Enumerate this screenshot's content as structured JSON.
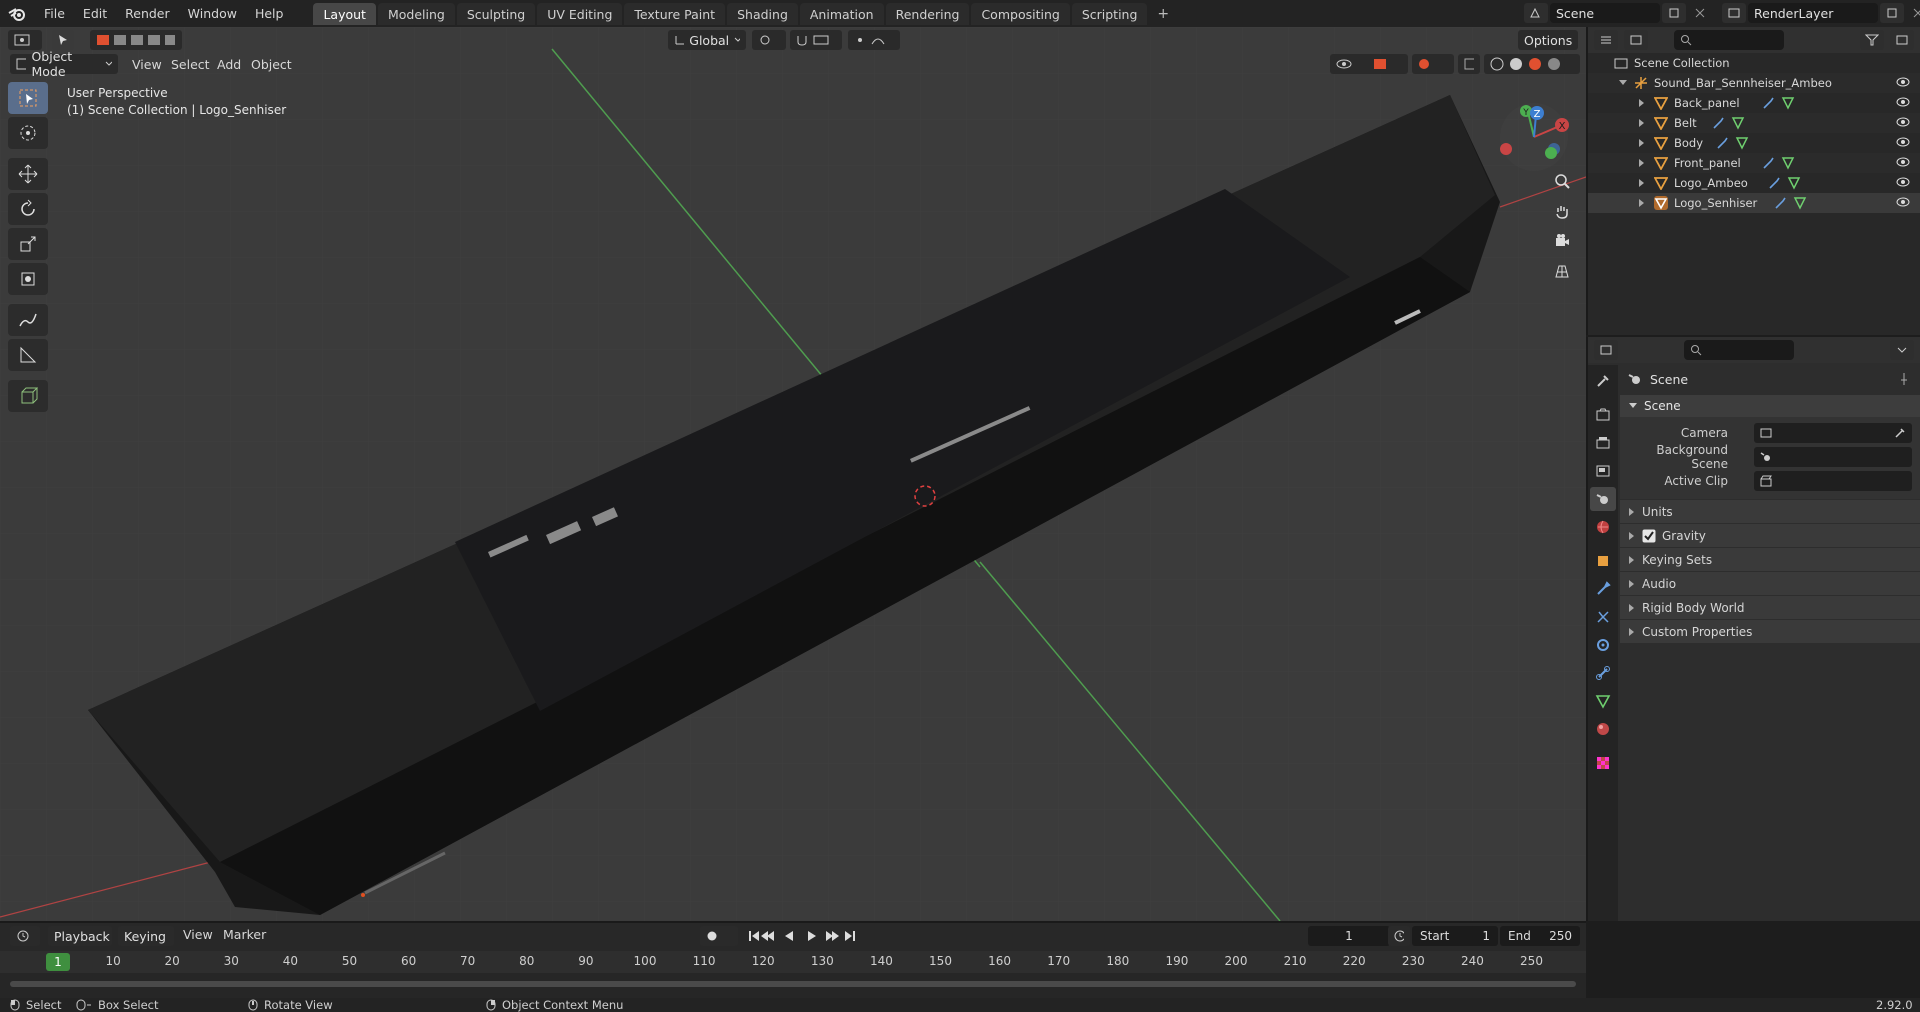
{
  "topbar": {
    "menu": [
      "File",
      "Edit",
      "Render",
      "Window",
      "Help"
    ],
    "workspaces": [
      "Layout",
      "Modeling",
      "Sculpting",
      "UV Editing",
      "Texture Paint",
      "Shading",
      "Animation",
      "Rendering",
      "Compositing",
      "Scripting"
    ],
    "active_workspace": "Layout",
    "add_tab": "+",
    "scene_name": "Scene",
    "view_layer": "RenderLayer"
  },
  "viewport": {
    "mode": "Object Mode",
    "menu": [
      "View",
      "Select",
      "Add",
      "Object"
    ],
    "orientation": "Global",
    "options": "Options",
    "perspective_label": "User Perspective",
    "collection_label": "(1) Scene Collection | Logo_Senhiser",
    "axes": {
      "x": "X",
      "y": "Y",
      "z": "Z"
    }
  },
  "outliner": {
    "root": "Scene Collection",
    "collection": "Sound_Bar_Sennheiser_Ambeo",
    "objects": [
      "Back_panel",
      "Belt",
      "Body",
      "Front_panel",
      "Logo_Ambeo",
      "Logo_Senhiser"
    ]
  },
  "properties": {
    "title": "Scene",
    "panel": "Scene",
    "fields": [
      {
        "label": "Camera"
      },
      {
        "label": "Background Scene"
      },
      {
        "label": "Active Clip"
      }
    ],
    "subpanels": [
      "Units",
      "Gravity",
      "Keying Sets",
      "Audio",
      "Rigid Body World",
      "Custom Properties"
    ],
    "gravity_checked": true
  },
  "timeline": {
    "menu": [
      "Playback",
      "Keying",
      "View",
      "Marker"
    ],
    "current_frame": "1",
    "start_label": "Start",
    "start": "1",
    "end_label": "End",
    "end": "250",
    "ruler": [
      "1",
      "10",
      "20",
      "30",
      "40",
      "50",
      "60",
      "70",
      "80",
      "90",
      "100",
      "110",
      "120",
      "130",
      "140",
      "150",
      "160",
      "170",
      "180",
      "190",
      "200",
      "210",
      "220",
      "230",
      "240",
      "250"
    ]
  },
  "statusbar": {
    "select": "Select",
    "box_select": "Box Select",
    "rotate": "Rotate View",
    "context": "Object Context Menu",
    "version": "2.92.0"
  },
  "colors": {
    "accent": "#4772b3",
    "axis_x": "#c94545",
    "axis_y": "#4caf50",
    "axis_z": "#3d7fd1",
    "frame": "#3f8f3f"
  }
}
